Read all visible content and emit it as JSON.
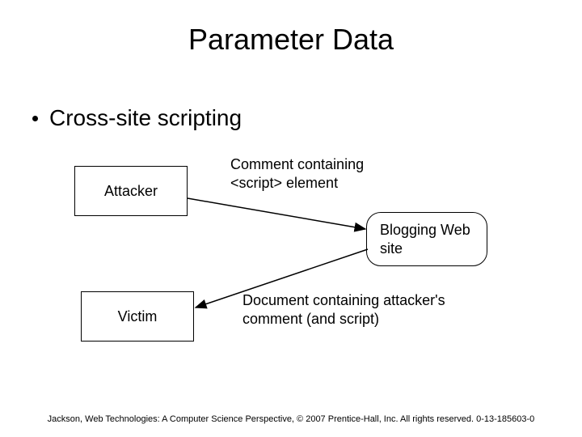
{
  "title": "Parameter Data",
  "bullet": "Cross-site scripting",
  "boxes": {
    "attacker": "Attacker",
    "victim": "Victim",
    "blog": "Blogging Web site"
  },
  "labels": {
    "comment_script": "Comment containing <script> element",
    "document_comment": "Document containing attacker's comment (and script)"
  },
  "footer": "Jackson, Web Technologies: A Computer Science Perspective, © 2007 Prentice-Hall, Inc. All rights reserved. 0-13-185603-0"
}
